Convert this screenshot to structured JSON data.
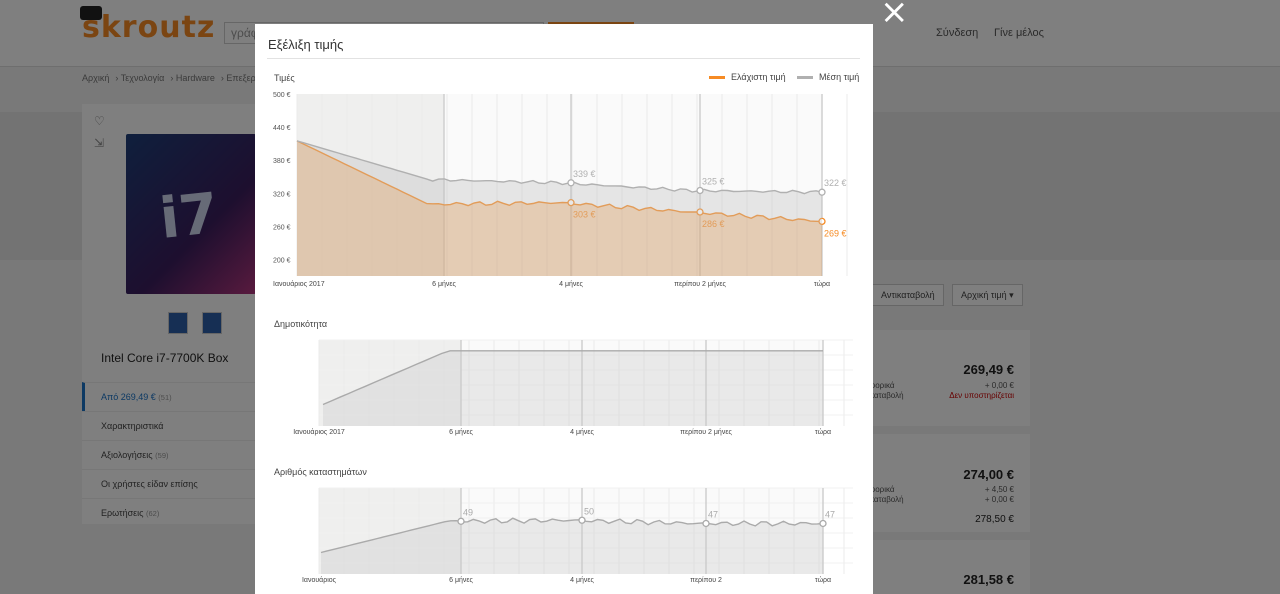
{
  "background": {
    "logo": "skroutz",
    "search_placeholder": "γράφ",
    "nav": {
      "login": "Σύνδεση",
      "signup": "Γίνε μέλος"
    },
    "breadcrumb": [
      "Αρχική",
      "Τεχνολογία",
      "Hardware",
      "Επεξερ"
    ],
    "product": {
      "name": "Intel Core i7-7700K Box",
      "box_text": "i7"
    },
    "side_menu": [
      {
        "label": "Από 269,49 €",
        "count": "(51)"
      },
      {
        "label": "Χαρακτηριστικά",
        "count": ""
      },
      {
        "label": "Αξιολογήσεις",
        "count": "(59)"
      },
      {
        "label": "Οι χρήστες είδαν επίσης",
        "count": ""
      },
      {
        "label": "Ερωτήσεις",
        "count": "(62)"
      }
    ],
    "filters": {
      "cod": "Αντικαταβολή",
      "sort": "Αρχική τιμή",
      "sort_icon": "caret-down-icon"
    },
    "offers": [
      {
        "price": "269,49 €",
        "line1_label": "φορικά",
        "line1": "+ 0,00 €",
        "line2_label": "καταβολή",
        "line2": "Δεν υποστηρίζεται"
      },
      {
        "price": "274,00 €",
        "line1_label": "φορικά",
        "line1": "+ 4,50 €",
        "line2_label": "καταβολή",
        "line2": "+ 0,00 €",
        "total": "278,50 €"
      },
      {
        "price": "281,58 €"
      }
    ]
  },
  "modal": {
    "title": "Εξέλιξη τιμής",
    "close_icon": "close-icon",
    "price_section": {
      "label": "Τιμές",
      "legend": [
        {
          "name": "Ελάχιστη τιμή",
          "color": "#f68b24"
        },
        {
          "name": "Μέση τιμή",
          "color": "#b0b0b0"
        }
      ]
    },
    "popularity_section": {
      "label": "Δημοτικότητα"
    },
    "stores_section": {
      "label": "Αριθμός καταστημάτων"
    }
  },
  "chart_data": [
    {
      "type": "line",
      "x": [
        "Ιανουάριος 2017",
        "6 μήνες",
        "4 μήνες",
        "περίπου 2 μήνες",
        "τώρα"
      ],
      "ylim": [
        170,
        500
      ],
      "yticks": [
        "500 €",
        "440 €",
        "380 €",
        "320 €",
        "260 €",
        "200 €"
      ],
      "series": [
        {
          "name": "Ελάχιστη τιμή",
          "color": "#f68b24",
          "values": [
            415,
            300,
            303,
            286,
            269
          ],
          "labels": [
            "",
            "",
            "303 €",
            "286 €",
            "269 €"
          ]
        },
        {
          "name": "Μέση τιμή",
          "color": "#b0b0b0",
          "values": [
            415,
            345,
            339,
            325,
            322
          ],
          "labels": [
            "",
            "",
            "339 €",
            "325 €",
            "322 €"
          ]
        }
      ]
    },
    {
      "type": "line",
      "x": [
        "Ιανουάριος 2017",
        "6 μήνες",
        "4 μήνες",
        "περίπου 2 μήνες",
        "τώρα"
      ],
      "series": [
        {
          "values": [
            20,
            70,
            70,
            70,
            70
          ]
        }
      ]
    },
    {
      "type": "line",
      "x": [
        "Ιανουάριος",
        "6 μήνες",
        "4 μήνες",
        "περίπου 2",
        "τώρα"
      ],
      "series": [
        {
          "values": [
            20,
            49,
            50,
            47,
            47
          ],
          "labels": [
            "",
            "49",
            "50",
            "47",
            "47"
          ]
        }
      ]
    }
  ]
}
